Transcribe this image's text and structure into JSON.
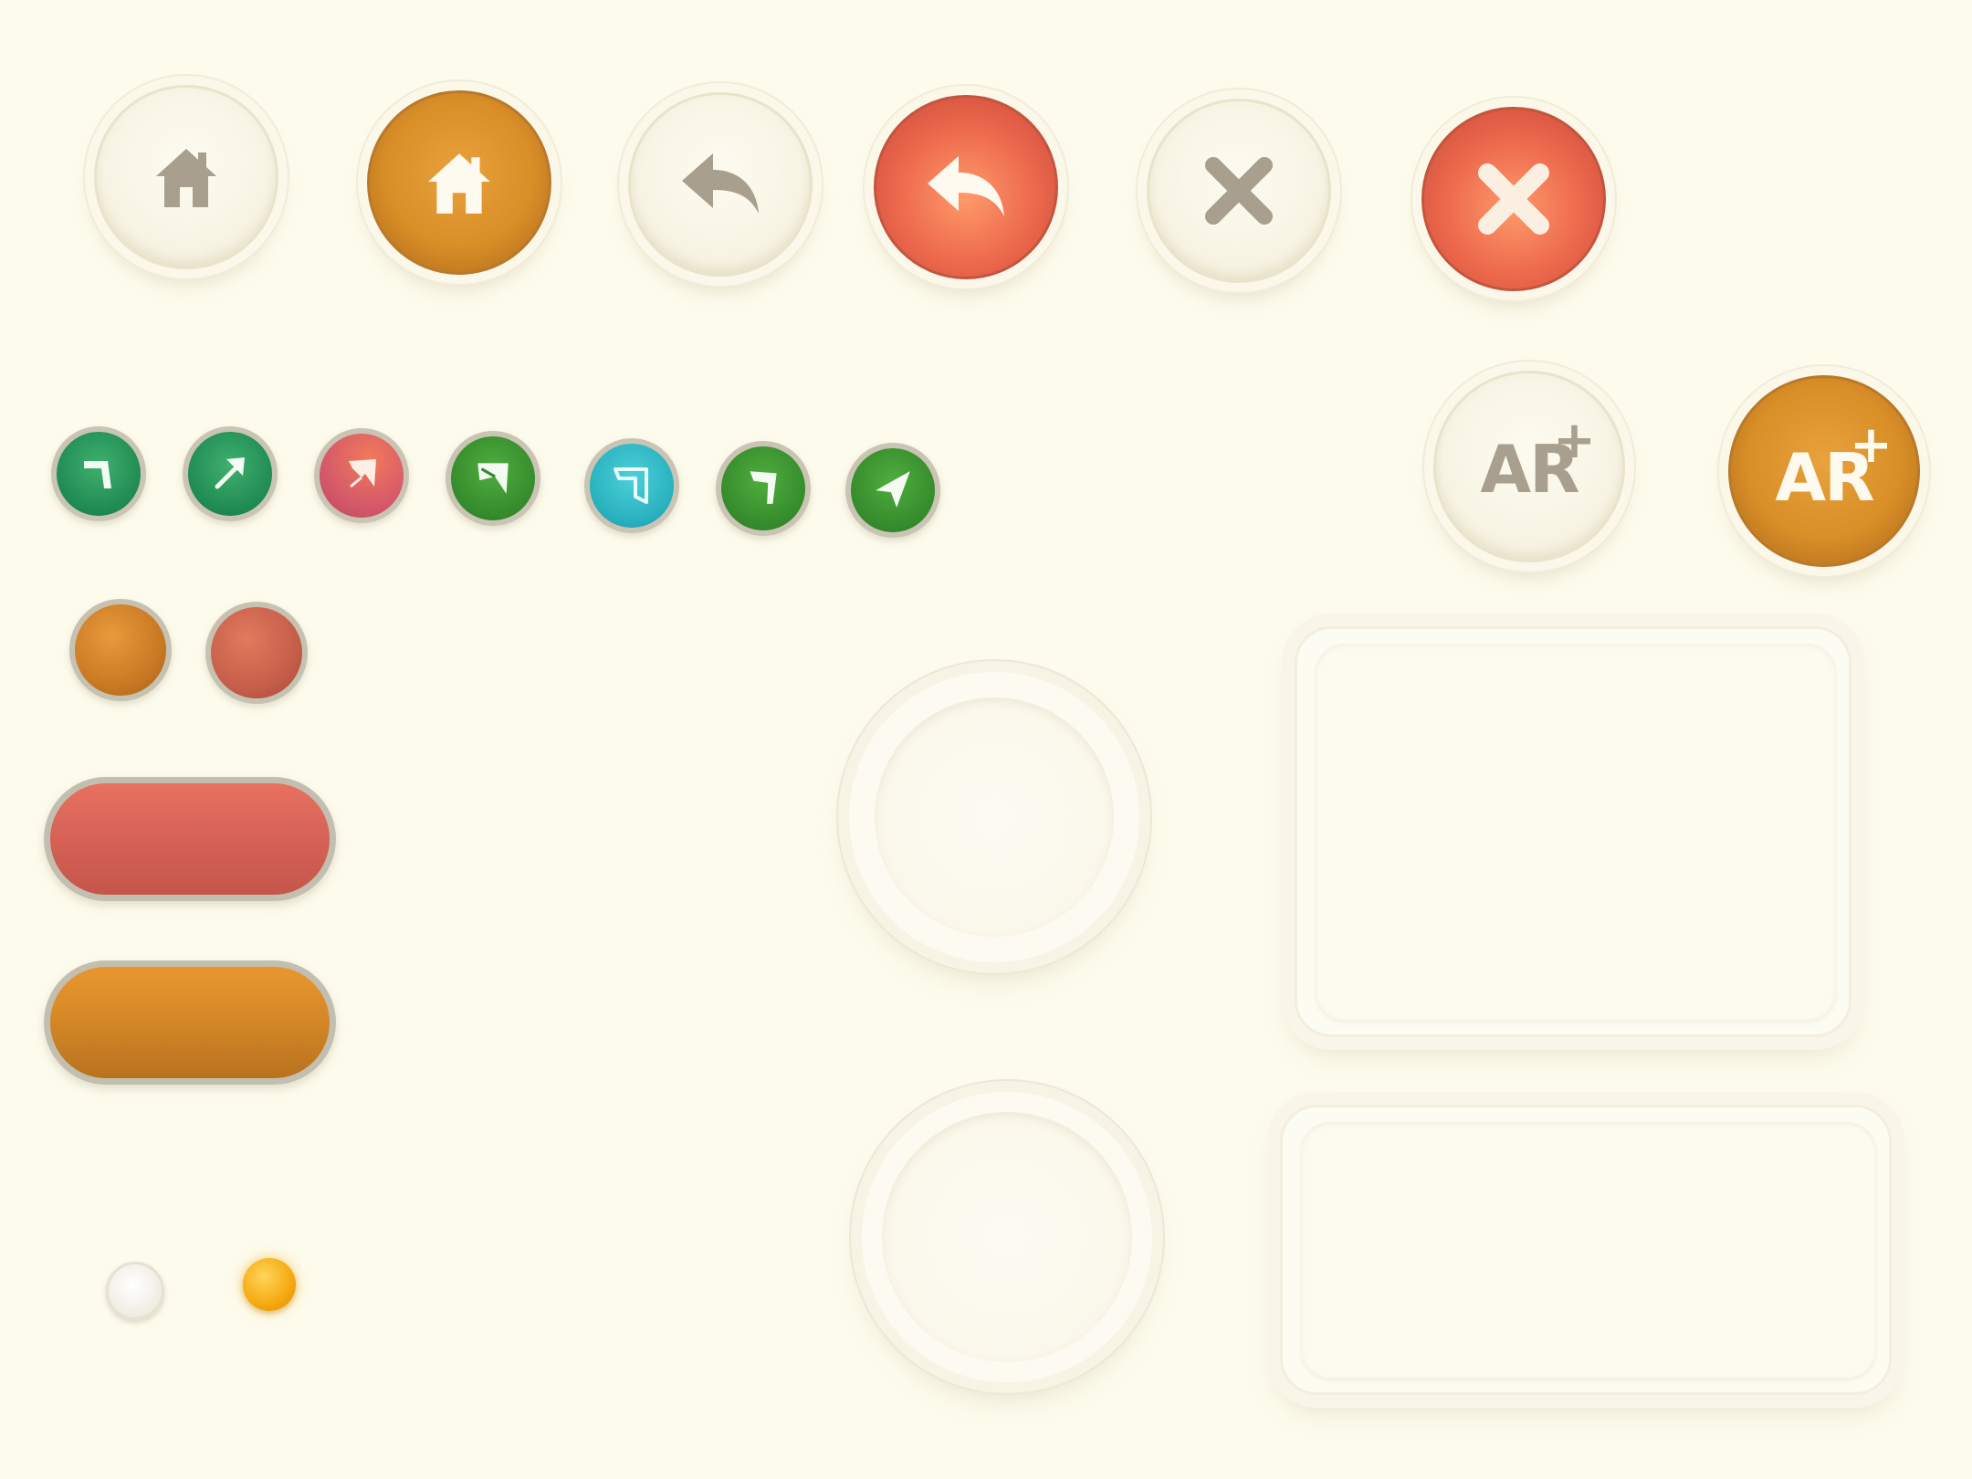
{
  "palette": {
    "background": "#fdfbec",
    "light_button": "#f8f4e4",
    "icon_gray": "#a89f8e",
    "orange": "#d98e27",
    "red": "#ed6a4d",
    "green": "#3e8a3a",
    "teal": "#38b8c4",
    "pink": "#d9606a",
    "indicator_yellow": "#f5a90f"
  },
  "top_toolbar": {
    "buttons": [
      {
        "icon": "home-icon",
        "style": "light"
      },
      {
        "icon": "home-icon",
        "style": "orange-active"
      },
      {
        "icon": "back-arrow-icon",
        "style": "light"
      },
      {
        "icon": "back-arrow-icon",
        "style": "red-active"
      },
      {
        "icon": "close-icon",
        "style": "light"
      },
      {
        "icon": "close-icon",
        "style": "red-active"
      }
    ]
  },
  "ar_buttons": {
    "label": "AR",
    "plus": "+",
    "states": [
      "light",
      "orange-active"
    ]
  },
  "arrow_buttons": [
    {
      "icon": "turn-left-arrow-icon",
      "color": "green"
    },
    {
      "icon": "diagonal-up-right-arrow-icon",
      "color": "green"
    },
    {
      "icon": "pointer-arrow-icon",
      "color": "pink"
    },
    {
      "icon": "pointer-arrow-icon",
      "color": "green"
    },
    {
      "icon": "turn-down-arrow-icon",
      "color": "teal"
    },
    {
      "icon": "turn-right-arrow-icon",
      "color": "green"
    },
    {
      "icon": "navigation-arrow-icon",
      "color": "green"
    }
  ],
  "round_color_buttons": [
    "orange",
    "red"
  ],
  "pill_buttons": [
    "red",
    "orange"
  ],
  "indicators": [
    {
      "state": "inactive",
      "color": "white"
    },
    {
      "state": "active",
      "color": "yellow"
    }
  ],
  "empty_panels": [
    "circle-slot",
    "rect-panel",
    "circle-slot",
    "rect-panel"
  ]
}
